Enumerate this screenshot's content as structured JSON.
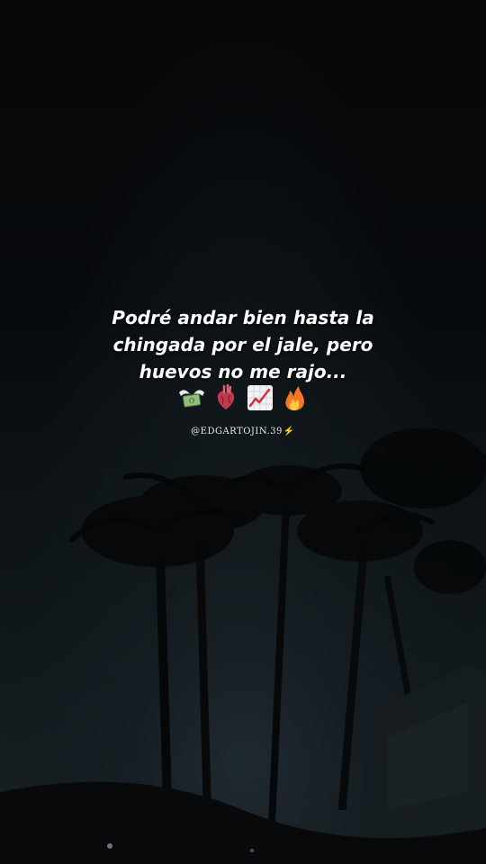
{
  "caption": {
    "lines": [
      "Podré andar bien hasta la",
      "chingada por el jale, pero",
      "huevos no me rajo..."
    ]
  },
  "emojis": [
    "money-with-wings-icon",
    "anatomical-heart-icon",
    "chart-increasing-icon",
    "fire-icon"
  ],
  "handle": {
    "text": "@EDGARTOJIN.39",
    "suffix": "⚡"
  },
  "colors": {
    "text": "#ffffff",
    "bolt": "#ffcc1a",
    "sky": "#07090b"
  }
}
